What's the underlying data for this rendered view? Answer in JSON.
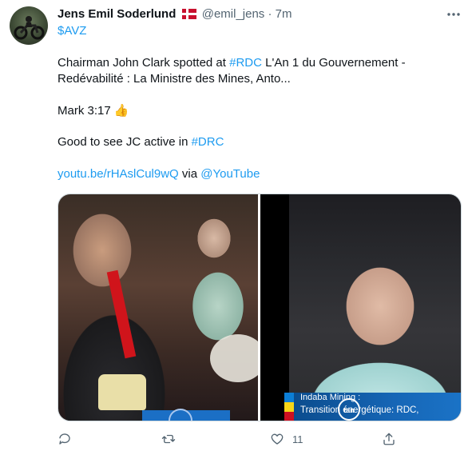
{
  "tweet": {
    "display_name": "Jens Emil Soderlund",
    "flag_emoji": "🇩🇰",
    "handle": "@emil_jens",
    "separator": "·",
    "time": "7m",
    "cashtag": "$AVZ",
    "line1_pre": "Chairman John Clark spotted at ",
    "line1_hashtag": "#RDC",
    "line1_post": " L'An 1 du Gouvernement -",
    "line2": "Redévabilité : La Ministre des Mines, Anto...",
    "mark_text": "Mark 3:17 ",
    "thumb_emoji": "👍",
    "jc_pre": "Good to see JC active in ",
    "jc_hashtag": "#DRC",
    "youtube_link": "youtu.be/rHAslCul9wQ",
    "via": " via ",
    "youtube_handle": "@YouTube"
  },
  "media": {
    "banner_title": "Indaba Mining :",
    "banner_subtitle": "Transition énergétique: RDC,",
    "logo_label": "tan"
  },
  "actions": {
    "reply_count": "",
    "retweet_count": "",
    "like_count": "11",
    "share_count": ""
  },
  "icons": {
    "more": "more-icon",
    "reply": "reply-icon",
    "retweet": "retweet-icon",
    "like": "heart-icon",
    "share": "share-icon"
  },
  "colors": {
    "link": "#1d9bf0",
    "muted": "#536471",
    "text": "#0f1419"
  }
}
